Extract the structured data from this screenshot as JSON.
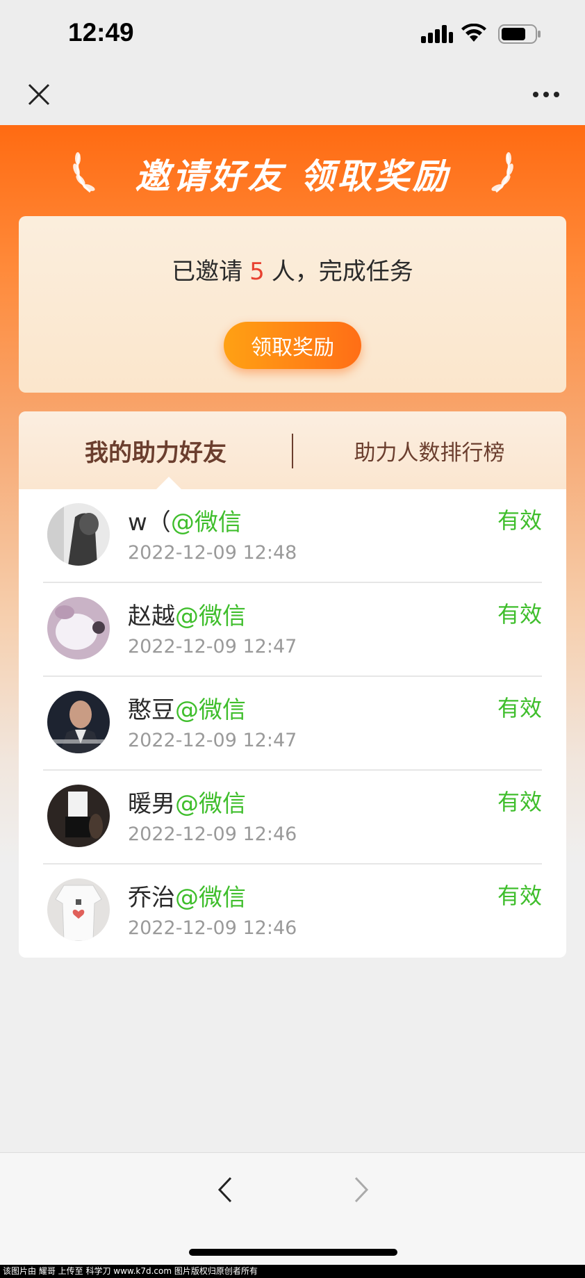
{
  "status_bar": {
    "time": "12:49"
  },
  "banner": {
    "title": "邀请好友  领取奖励"
  },
  "invite": {
    "prefix": "已邀请",
    "count": "5",
    "suffix": "人，完成任务",
    "claim_label": "领取奖励"
  },
  "tabs": {
    "mine": "我的助力好友",
    "ranking": "助力人数排行榜"
  },
  "friends": [
    {
      "name": "w（",
      "source": "@微信",
      "time": "2022-12-09 12:48",
      "status": "有效"
    },
    {
      "name": "赵越",
      "source": "@微信",
      "time": "2022-12-09 12:47",
      "status": "有效"
    },
    {
      "name": "憨豆",
      "source": "@微信",
      "time": "2022-12-09 12:47",
      "status": "有效"
    },
    {
      "name": "暖男",
      "source": "@微信",
      "time": "2022-12-09 12:46",
      "status": "有效"
    },
    {
      "name": "乔治",
      "source": "@微信",
      "time": "2022-12-09 12:46",
      "status": "有效"
    }
  ],
  "watermark": "该图片由 耀哥 上传至 科学刀 www.k7d.com 图片版权归原创者所有",
  "colors": {
    "accent": "#ff6b12",
    "valid_green": "#3fbe2c",
    "count_red": "#e8402f",
    "tab_brown": "#6b3e2e"
  }
}
